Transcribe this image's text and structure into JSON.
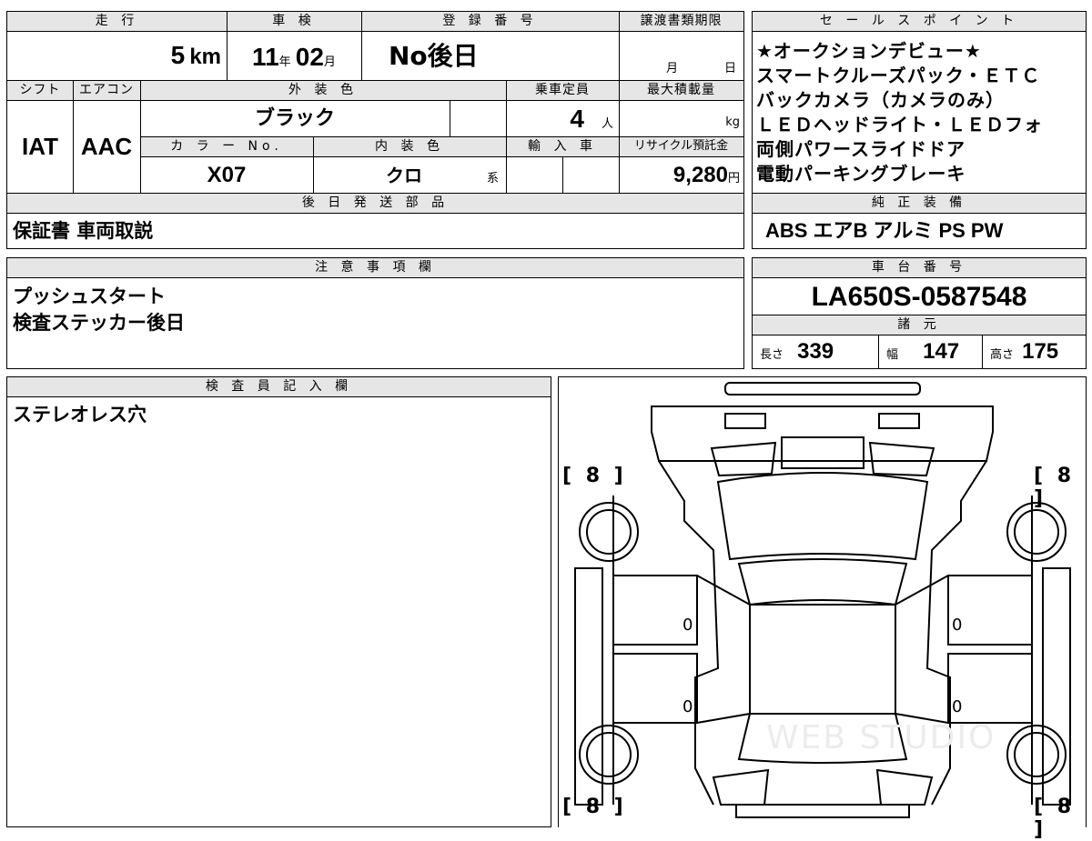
{
  "top_info": {
    "mileage_header": "走 行",
    "mileage_value": "5",
    "mileage_unit": "km",
    "inspection_header": "車 検",
    "inspection_year": "11",
    "inspection_year_unit": "年",
    "inspection_month": "02",
    "inspection_month_unit": "月",
    "registration_header": "登 録 番 号",
    "registration_value": "No後日",
    "transfer_header": "譲渡書類期限",
    "transfer_month_unit": "月",
    "transfer_day_unit": "日",
    "shift_header": "シフト",
    "shift_value": "IAT",
    "ac_header": "エアコン",
    "ac_value": "AAC",
    "exterior_color_header": "外 装 色",
    "exterior_color_value": "ブラック",
    "capacity_header": "乗車定員",
    "capacity_value": "4",
    "capacity_unit": "人",
    "max_load_header": "最大積載量",
    "max_load_unit": "kg",
    "color_no_header": "カ ラ ー No.",
    "color_no_value": "X07",
    "interior_color_header": "内 装 色",
    "interior_color_value": "クロ",
    "interior_color_unit": "系",
    "import_header": "輸 入 車",
    "recycle_header": "リサイクル預託金",
    "recycle_value": "9,280",
    "recycle_unit": "円",
    "later_parts_header": "後 日 発 送 部 品",
    "later_parts_value": "保証書 車両取説"
  },
  "sales_points": {
    "header": "セ ー ル ス ポ イ ン ト",
    "lines": [
      "★オークションデビュー★",
      "スマートクルーズパック・ＥＴＣ",
      "バックカメラ（カメラのみ）",
      "ＬＥＤヘッドライト・ＬＥＤフォ",
      "両側パワースライドドア",
      "電動パーキングブレーキ"
    ],
    "equipment_header": "純 正 装 備",
    "equipment_value": "ABS エアB アルミ PS PW"
  },
  "notes": {
    "header": "注 意 事 項 欄",
    "lines": [
      "プッシュスタート",
      "検査ステッカー後日"
    ]
  },
  "chassis": {
    "header": "車 台 番 号",
    "value": "LA650S-0587548",
    "spec_header": "諸 元",
    "length_label": "長さ",
    "length_value": "339",
    "width_label": "幅",
    "width_value": "147",
    "height_label": "高さ",
    "height_value": "175"
  },
  "inspector": {
    "header": "検 査 員 記 入 欄",
    "value": "ステレオレス穴"
  },
  "diagram": {
    "tire_front_left": "[ 8 ]",
    "tire_front_right": "[ 8 ]",
    "tire_rear_left": "[ 8 ]",
    "tire_rear_right": "[ 8 ]",
    "door_front_left": "0",
    "door_front_right": "0",
    "door_rear_left": "0",
    "door_rear_right": "0",
    "watermark": "WEB STUDIO"
  }
}
